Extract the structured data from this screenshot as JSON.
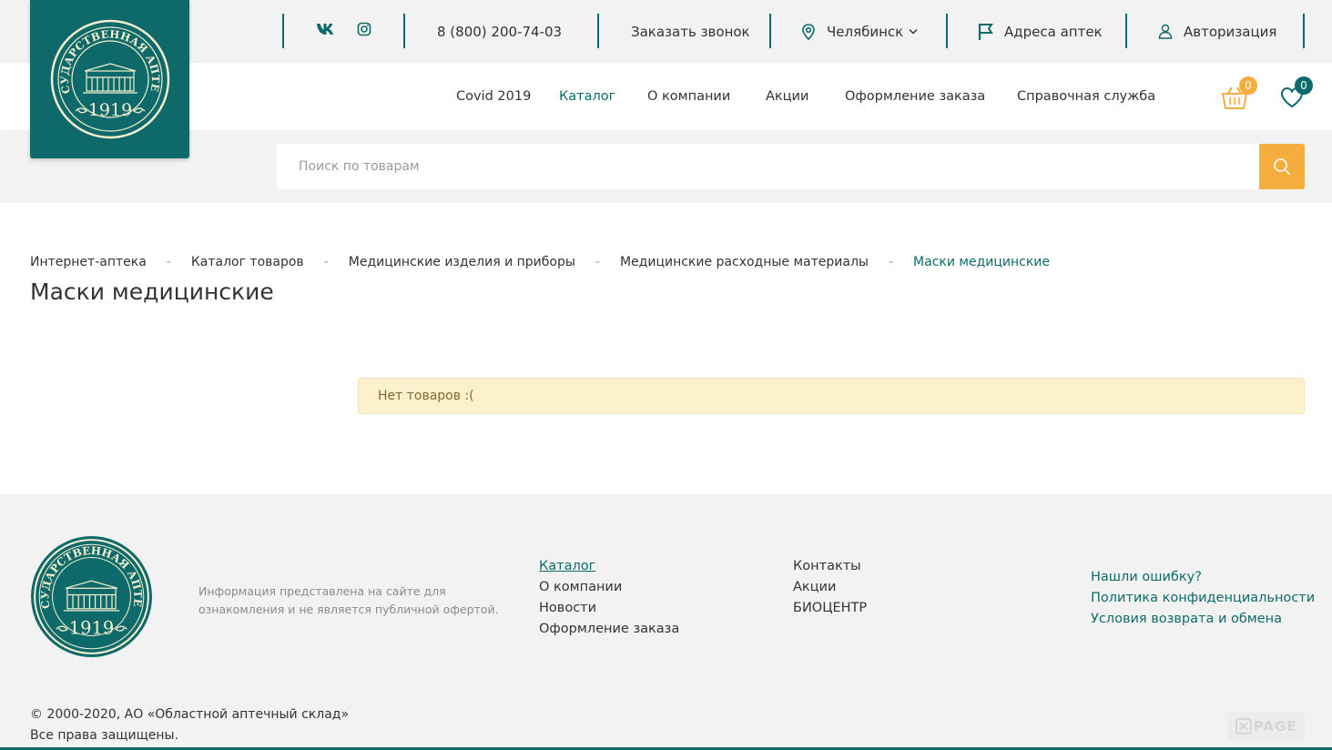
{
  "header": {
    "phone": "8 (800) 200-74-03",
    "callback_label": "Заказать звонок",
    "city": "Челябинск",
    "addresses_label": "Адреса аптек",
    "login_label": "Авторизация",
    "social": [
      "vk-icon",
      "instagram-icon"
    ]
  },
  "logo": {
    "text_top": "ГОСУДАРСТВЕННАЯ АПТЕКА",
    "year": "1919"
  },
  "nav": {
    "items": [
      {
        "label": "Covid 2019"
      },
      {
        "label": "Каталог"
      },
      {
        "label": "О компании"
      },
      {
        "label": "Акции"
      },
      {
        "label": "Оформление заказа"
      },
      {
        "label": "Справочная служба"
      }
    ],
    "cart_count": "0",
    "favorites_count": "0"
  },
  "search": {
    "placeholder": "Поиск по товарам"
  },
  "breadcrumb": {
    "items": [
      "Интернет-аптека",
      "Каталог товаров",
      "Медицинские изделия и приборы",
      "Медицинские расходные материалы",
      "Маски медицинские"
    ],
    "separator": "-"
  },
  "page": {
    "title": "Маски медицинские",
    "notice": "Нет товаров :("
  },
  "footer": {
    "info": "Информация представлена на сайте для ознакомления и не является публичной офертой.",
    "col1": [
      "Каталог",
      "О компании",
      "Новости",
      "Оформление заказа"
    ],
    "col2": [
      "Контакты",
      "Акции",
      "БИОЦЕНТР"
    ],
    "col3": [
      "Нашли ошибку?",
      "Политика конфиденциальности",
      "Условия возврата и обмена"
    ],
    "copyright_line1": "© 2000-2020, АО «Областной аптечный склад»",
    "copyright_line2": "Все права защищены.",
    "badge": "PAGE"
  },
  "colors": {
    "brand": "#0e6a6a",
    "accent": "#f5ae3d",
    "background": "#f2f2f2"
  }
}
